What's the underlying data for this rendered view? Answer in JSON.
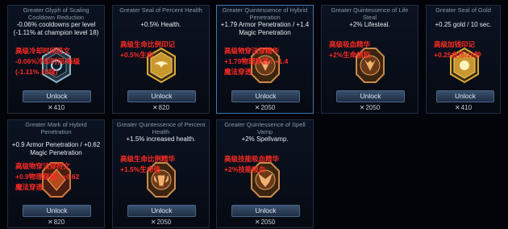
{
  "cards": [
    {
      "title": "Greater Glyph of Scaling Cooldown Reduction",
      "desc": "-0.06% cooldowns per level (-1.11% at champion level 18)",
      "note": "高级冷却时间符文\n-0.06%冷却时间/每级\n(-1.11% 18级)",
      "unlock": "Unlock",
      "price": "410",
      "icon": "glyph-icon"
    },
    {
      "title": "Greater Seal of Percent Health",
      "desc": "+0.5% Health.",
      "note": "高级生命比例印记\n+0.5%生命",
      "unlock": "Unlock",
      "price": "820",
      "icon": "seal-wings-icon"
    },
    {
      "title": "Greater Quintessence of Hybrid Penetration",
      "desc": "+1.79 Armor Penetration / +1.4 Magic Penetration",
      "note": "高级物穿法穿精华\n+1.79物理穿透 / +1.4\n魔法穿透",
      "unlock": "Unlock",
      "price": "2050",
      "icon": "quintessence-demon-icon"
    },
    {
      "title": "Greater Quintessence of Life Steal",
      "desc": "+2% Lifesteal.",
      "note": "高级吸血精华\n+2%生命偷取",
      "unlock": "Unlock",
      "price": "2050",
      "icon": "quintessence-demon-icon"
    },
    {
      "title": "Greater Seal of Gold",
      "desc": "+0.25 gold / 10 sec.",
      "note": "高级加钱印记\n+0.25金币/10秒",
      "unlock": "Unlock",
      "price": "410",
      "icon": "seal-coin-icon"
    },
    {
      "title": "Greater Mark of Hybrid Penetration",
      "desc": "+0.9 Armor Penetration / +0.62 Magic Penetration",
      "note": "高级物穿法穿符文\n+0.9物理穿透 / +0.62\n魔法穿透",
      "unlock": "Unlock",
      "price": "820",
      "icon": "mark-icon"
    },
    {
      "title": "Greater Quintessence of Percent Health",
      "desc": "+1.5% increased health.",
      "note": "高级生命比例精华\n+1.5%生命值",
      "unlock": "Unlock",
      "price": "2050",
      "icon": "quintessence-ram-icon"
    },
    {
      "title": "Greater Quintessence of Spell Vamp",
      "desc": "+2% Spellvamp.",
      "note": "高级技能吸血精华\n+2%技能吸血",
      "unlock": "Unlock",
      "price": "2050",
      "icon": "quintessence-vamp-icon"
    }
  ],
  "colors": {
    "note": "#ff2b24",
    "accent": "#3d79b8",
    "gold": "#c9972e"
  }
}
